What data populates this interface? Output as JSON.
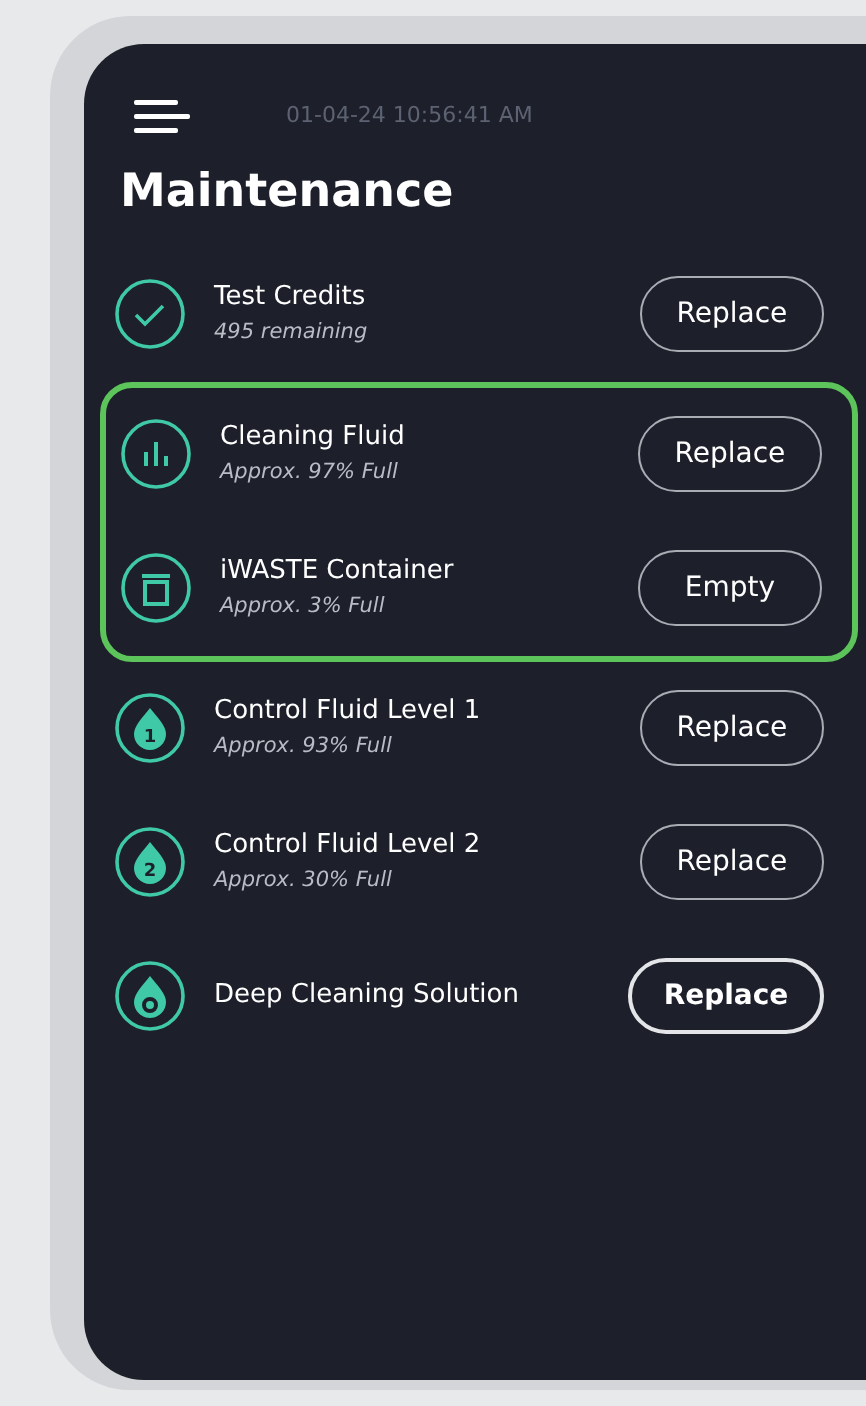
{
  "header": {
    "timestamp": "01-04-24 10:56:41 AM"
  },
  "title": "Maintenance",
  "items": [
    {
      "kind": "check",
      "name": "Test Credits",
      "detail": "495 remaining",
      "button": "Replace",
      "button_emphasis": false,
      "highlighted": false
    },
    {
      "kind": "bars",
      "name": "Cleaning Fluid",
      "detail": "Approx. 97% Full",
      "button": "Replace",
      "button_emphasis": false,
      "highlighted": true
    },
    {
      "kind": "bin",
      "name": "iWASTE Container",
      "detail": "Approx. 3% Full",
      "button": "Empty",
      "button_emphasis": false,
      "highlighted": true
    },
    {
      "kind": "drop",
      "badge": "1",
      "name": "Control Fluid Level 1",
      "detail": "Approx. 93% Full",
      "button": "Replace",
      "button_emphasis": false,
      "highlighted": false
    },
    {
      "kind": "drop",
      "badge": "2",
      "name": "Control Fluid Level 2",
      "detail": "Approx. 30% Full",
      "button": "Replace",
      "button_emphasis": false,
      "highlighted": false
    },
    {
      "kind": "drop-dot",
      "name": "Deep Cleaning Solution",
      "button": "Replace",
      "button_emphasis": true,
      "highlighted": false
    }
  ]
}
